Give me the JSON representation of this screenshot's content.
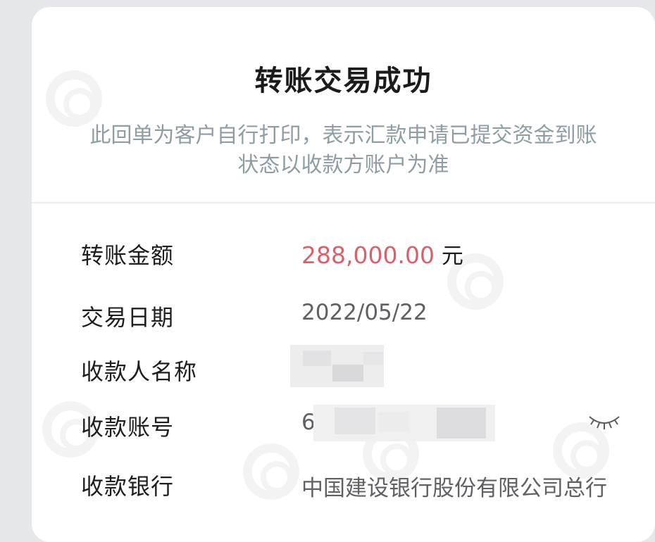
{
  "receipt": {
    "title": "转账交易成功",
    "notice": "此回单为客户自行打印，表示汇款申请已提交资金到账状态以收款方账户为准",
    "fields": {
      "amount_label": "转账金额",
      "amount_value": "288,000.00",
      "amount_unit": "元",
      "date_label": "交易日期",
      "date_value": "2022/05/22",
      "payee_name_label": "收款人名称",
      "payee_account_label": "收款账号",
      "payee_account_prefix": "6",
      "payee_bank_label": "收款银行",
      "payee_bank_value": "中国建设银行股份有限公司总行"
    },
    "icons": {
      "toggle_visibility": "eye-closed-icon",
      "watermark": "bank-logo-watermark"
    }
  }
}
